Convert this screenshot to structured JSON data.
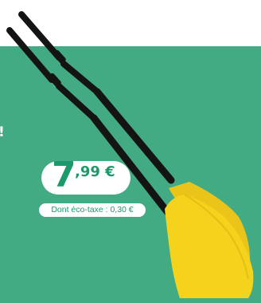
{
  "price": {
    "integer": "7",
    "decimal": ",99 €"
  },
  "eco_tax": {
    "label": "Dont éco-taxe : 0,30 €"
  },
  "side_text": {
    "mark": "!"
  },
  "colors": {
    "background_green": "#43ab83",
    "price_green": "#1d9a6c",
    "paddle_yellow": "#f5d21c",
    "shaft_black": "#141414"
  },
  "icons": {
    "product": "paddle-pair-icon"
  }
}
